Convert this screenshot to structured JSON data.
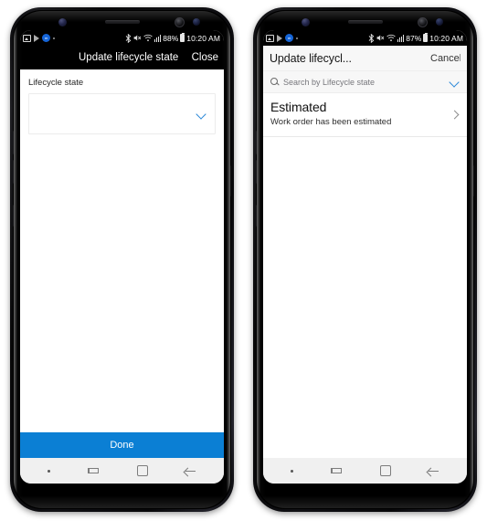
{
  "colors": {
    "accent_blue": "#0b7fd4",
    "chevron_blue": "#2b88d8",
    "appbar_dark": "#000000",
    "appbar_light": "#f7f7f7",
    "navbar": "#f0f0f0"
  },
  "phone_left": {
    "status_bar": {
      "battery_percent": "88%",
      "time": "10:20 AM",
      "icons": [
        "screenshot-icon",
        "play-store-icon",
        "app-badge-icon",
        "dot-icon",
        "bluetooth-icon",
        "mute-icon",
        "wifi-icon",
        "signal-icon",
        "battery-icon"
      ]
    },
    "app_bar": {
      "title": "Update lifecycle state",
      "action_label": "Close"
    },
    "form": {
      "field_label": "Lifecycle state",
      "combo_value": "",
      "combo_placeholder": ""
    },
    "footer": {
      "done_label": "Done"
    },
    "nav_bar": {
      "items": [
        "dot-indicator",
        "recents-button",
        "home-button",
        "back-button"
      ]
    }
  },
  "phone_right": {
    "status_bar": {
      "battery_percent": "87%",
      "time": "10:20 AM",
      "icons": [
        "screenshot-icon",
        "play-store-icon",
        "app-badge-icon",
        "dot-icon",
        "bluetooth-icon",
        "mute-icon",
        "wifi-icon",
        "signal-icon",
        "battery-icon"
      ]
    },
    "app_bar": {
      "title": "Update lifecycl...",
      "action_label": "Cancel"
    },
    "search": {
      "placeholder": "Search by Lifecycle state"
    },
    "list": {
      "items": [
        {
          "title": "Estimated",
          "subtitle": "Work order has been estimated"
        }
      ]
    },
    "nav_bar": {
      "items": [
        "dot-indicator",
        "recents-button",
        "home-button",
        "back-button"
      ]
    }
  }
}
